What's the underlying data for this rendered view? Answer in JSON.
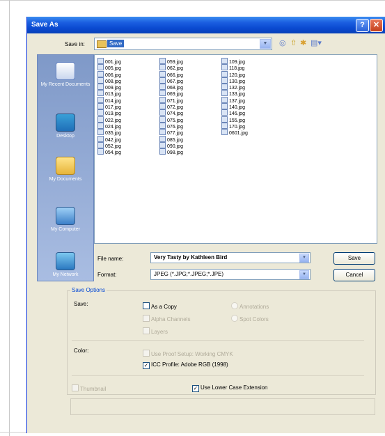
{
  "dialog": {
    "title": "Save As",
    "help_glyph": "?",
    "close_glyph": "✕"
  },
  "save_in": {
    "label": "Save in:",
    "folder": "Save",
    "arrow": "▼",
    "toolbar_icons": [
      "back-icon",
      "up-folder-icon",
      "new-folder-icon",
      "views-menu-icon"
    ]
  },
  "places": [
    {
      "label": "My Recent Documents",
      "icon": "recent-documents-icon"
    },
    {
      "label": "Desktop",
      "icon": "desktop-icon"
    },
    {
      "label": "My Documents",
      "icon": "my-documents-icon"
    },
    {
      "label": "My Computer",
      "icon": "my-computer-icon"
    },
    {
      "label": "My Network",
      "icon": "my-network-icon"
    }
  ],
  "files": {
    "col1": [
      "001.jpg",
      "005.jpg",
      "006.jpg",
      "008.jpg",
      "009.jpg",
      "013.jpg",
      "014.jpg",
      "017.jpg",
      "019.jpg",
      "022.jpg",
      "024.jpg",
      "035.jpg",
      "042.jpg",
      "052.jpg",
      "054.jpg"
    ],
    "col2": [
      "059.jpg",
      "062.jpg",
      "066.jpg",
      "067.jpg",
      "068.jpg",
      "069.jpg",
      "071.jpg",
      "072.jpg",
      "074.jpg",
      "075.jpg",
      "076.jpg",
      "077.jpg",
      "085.jpg",
      "090.jpg",
      "098.jpg"
    ],
    "col3": [
      "109.jpg",
      "118.jpg",
      "120.jpg",
      "130.jpg",
      "132.jpg",
      "133.jpg",
      "137.jpg",
      "140.jpg",
      "146.jpg",
      "155.jpg",
      "170.jpg",
      "0601.jpg"
    ]
  },
  "form": {
    "file_name_label": "File name:",
    "file_name_value": "Very Tasty by Kathleen Bird",
    "format_label": "Format:",
    "format_value": "JPEG (*.JPG;*.JPEG;*.JPE)",
    "save_button": "Save",
    "cancel_button": "Cancel",
    "arrow": "▼"
  },
  "save_options": {
    "caption": "Save Options",
    "save_label": "Save:",
    "as_a_copy": "As a Copy",
    "annotations": "Annotations",
    "alpha_channels": "Alpha Channels",
    "spot_colors": "Spot Colors",
    "layers": "Layers",
    "color_label": "Color:",
    "use_proof_setup": "Use Proof Setup: Working CMYK",
    "icc_profile": "ICC Profile: Adobe RGB (1998)",
    "thumbnail": "Thumbnail",
    "lower_case_ext": "Use Lower Case Extension",
    "check": "✓"
  }
}
